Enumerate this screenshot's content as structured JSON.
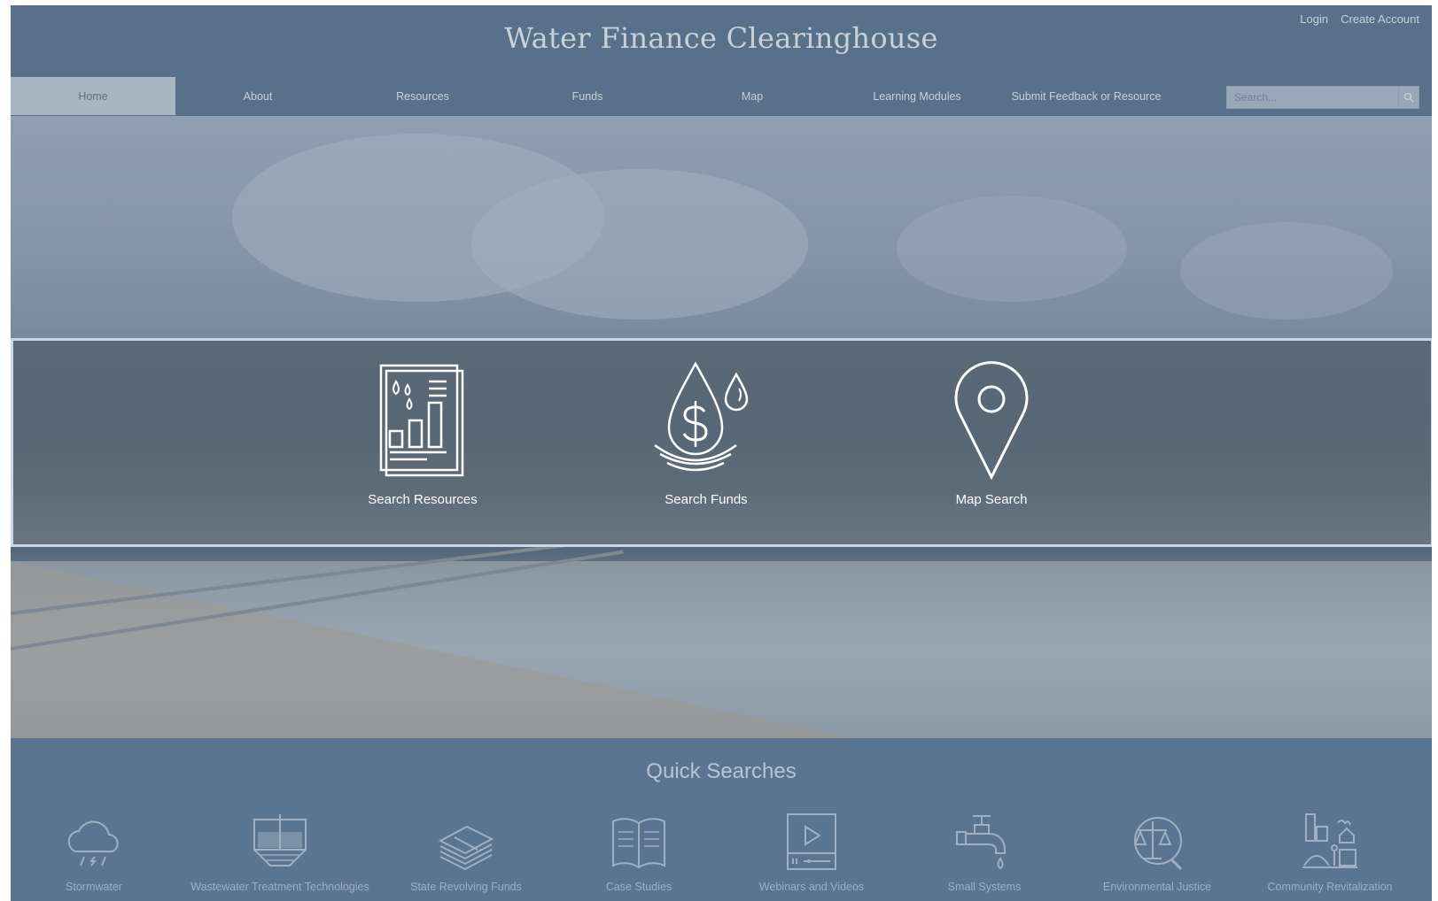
{
  "header": {
    "title": "Water Finance Clearinghouse",
    "login": "Login",
    "create_account": "Create Account"
  },
  "nav": {
    "items": [
      {
        "label": "Home"
      },
      {
        "label": "About"
      },
      {
        "label": "Resources"
      },
      {
        "label": "Funds"
      },
      {
        "label": "Map"
      },
      {
        "label": "Learning Modules"
      },
      {
        "label": "Submit Feedback or Resource"
      }
    ],
    "search_placeholder": "Search..."
  },
  "hero": {
    "actions": [
      {
        "label": "Search Resources",
        "icon": "document-chart-icon"
      },
      {
        "label": "Search Funds",
        "icon": "water-drop-dollar-icon"
      },
      {
        "label": "Map Search",
        "icon": "map-pin-icon"
      }
    ]
  },
  "quick_searches": {
    "title": "Quick Searches",
    "items": [
      {
        "label": "Stormwater",
        "icon": "rain-cloud-icon"
      },
      {
        "label": "Wastewater Treatment Technologies",
        "icon": "treatment-tank-icon"
      },
      {
        "label": "State Revolving Funds",
        "icon": "money-stack-icon"
      },
      {
        "label": "Case Studies",
        "icon": "open-book-icon"
      },
      {
        "label": "Webinars and Videos",
        "icon": "video-player-icon"
      },
      {
        "label": "Small Systems",
        "icon": "faucet-icon"
      },
      {
        "label": "Environmental Justice",
        "icon": "scales-icon"
      },
      {
        "label": "Community Revitalization",
        "icon": "community-icon"
      }
    ]
  },
  "colors": {
    "header_bg": "#587089",
    "nav_active_bg": "#a8b6c4",
    "quick_bg": "#5a7590",
    "band_border": "#c8d8ea"
  }
}
